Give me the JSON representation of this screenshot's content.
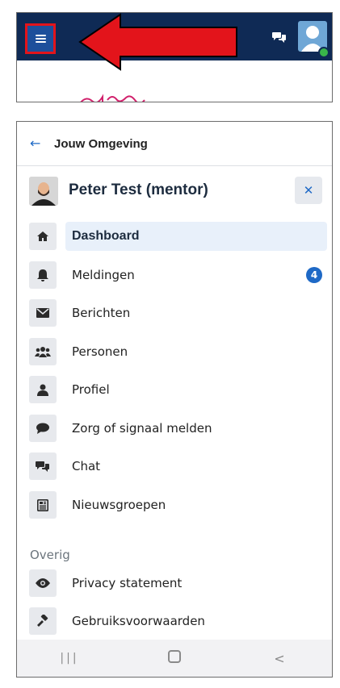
{
  "top_bar": {
    "colors": {
      "bar": "#0f2a55",
      "highlight": "#e3141b",
      "arrow": "#e3141b"
    },
    "menu_icon": "hamburger-icon",
    "chat_icon": "chat-icon",
    "avatar_icon": "user-avatar"
  },
  "panel": {
    "title": "Jouw Omgeving",
    "back_icon": "arrow-left-icon",
    "user_name": "Peter Test (mentor)",
    "close_icon": "close-icon"
  },
  "nav": {
    "items": [
      {
        "label": "Dashboard",
        "icon": "home-icon",
        "active": true
      },
      {
        "label": "Meldingen",
        "icon": "bell-icon",
        "badge": "4"
      },
      {
        "label": "Berichten",
        "icon": "envelope-icon"
      },
      {
        "label": "Personen",
        "icon": "users-icon"
      },
      {
        "label": "Profiel",
        "icon": "user-icon"
      },
      {
        "label": "Zorg of signaal melden",
        "icon": "comment-icon"
      },
      {
        "label": "Chat",
        "icon": "chat-icon"
      },
      {
        "label": "Nieuwsgroepen",
        "icon": "newspaper-icon"
      }
    ],
    "section_label": "Overig",
    "other_items": [
      {
        "label": "Privacy statement",
        "icon": "eye-icon"
      },
      {
        "label": "Gebruiksvoorwaarden",
        "icon": "gavel-icon"
      }
    ]
  },
  "system_nav": {
    "recent": "|||",
    "back": "<"
  },
  "colors": {
    "accent": "#1e69c6",
    "active_bg": "#e8f0fa",
    "icon_bg": "#e7e9ed"
  }
}
